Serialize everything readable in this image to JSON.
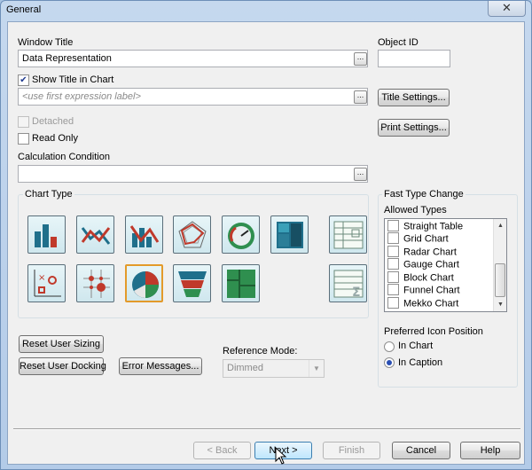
{
  "window": {
    "title": "General",
    "close_glyph": "✕"
  },
  "form": {
    "window_title_label": "Window Title",
    "window_title_value": "Data Representation",
    "object_id_label": "Object ID",
    "object_id_value": "",
    "show_title_label": "Show Title in Chart",
    "show_title_checked": true,
    "title_expression_placeholder": "<use first expression label>",
    "title_settings_button": "Title Settings...",
    "print_settings_button": "Print Settings...",
    "detached_label": "Detached",
    "read_only_label": "Read Only",
    "calculation_condition_label": "Calculation Condition",
    "calculation_condition_value": "",
    "ellipsis": "..."
  },
  "chart_type": {
    "group_title": "Chart Type",
    "icons": [
      "bar-chart-icon",
      "line-chart-icon",
      "combo-chart-icon",
      "radar-chart-icon",
      "gauge-chart-icon",
      "block-chart-icon",
      "pivot-table-icon",
      "scatter-chart-icon",
      "grid-chart-icon",
      "pie-chart-icon",
      "funnel-chart-icon",
      "mekko-chart-icon",
      "straight-table-icon"
    ],
    "selected": "pie-chart-icon"
  },
  "fast_type_change": {
    "group_title": "Fast Type Change",
    "allowed_types_label": "Allowed Types",
    "items": [
      "Straight Table",
      "Grid Chart",
      "Radar Chart",
      "Gauge Chart",
      "Block Chart",
      "Funnel Chart",
      "Mekko Chart"
    ],
    "preferred_icon_position_label": "Preferred Icon Position",
    "in_chart_label": "In Chart",
    "in_caption_label": "In Caption",
    "selected_position": "In Caption"
  },
  "bottom_left": {
    "reset_user_sizing": "Reset User Sizing",
    "reset_user_docking": "Reset User Docking",
    "error_messages": "Error Messages...",
    "reference_mode_label": "Reference Mode:",
    "reference_mode_value": "Dimmed"
  },
  "footer": {
    "back": "< Back",
    "next": "Next >",
    "finish": "Finish",
    "cancel": "Cancel",
    "help": "Help"
  },
  "colors": {
    "selection_border": "#e39a2a",
    "checkmark": "#1f3a8f"
  }
}
